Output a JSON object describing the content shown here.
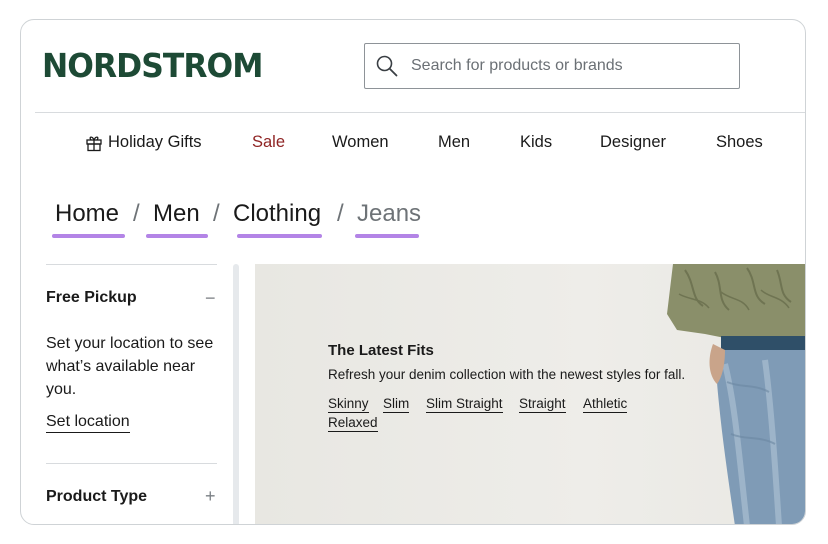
{
  "brand": {
    "logo_text": "NORDSTROM",
    "color": "#1d4a35"
  },
  "search": {
    "placeholder": "Search for products or brands",
    "icon": "search-icon"
  },
  "nav": {
    "items": [
      {
        "label": "Holiday Gifts",
        "icon": "gift-icon"
      },
      {
        "label": "Sale",
        "color": "#8f2424"
      },
      {
        "label": "Women"
      },
      {
        "label": "Men"
      },
      {
        "label": "Kids"
      },
      {
        "label": "Designer"
      },
      {
        "label": "Shoes"
      }
    ]
  },
  "breadcrumb": {
    "items": [
      "Home",
      "Men",
      "Clothing",
      "Jeans"
    ],
    "separator": "/",
    "underline_color": "#b384e6"
  },
  "sidebar": {
    "free_pickup": {
      "title": "Free Pickup",
      "toggle": "−",
      "text": "Set your location to see what’s available near you.",
      "link": "Set location"
    },
    "product_type": {
      "title": "Product Type",
      "toggle": "+"
    }
  },
  "hero": {
    "title": "The Latest Fits",
    "subtitle": "Refresh your denim collection with the newest styles for fall.",
    "links": [
      "Skinny",
      "Slim",
      "Slim Straight",
      "Straight",
      "Athletic",
      "Relaxed"
    ]
  }
}
